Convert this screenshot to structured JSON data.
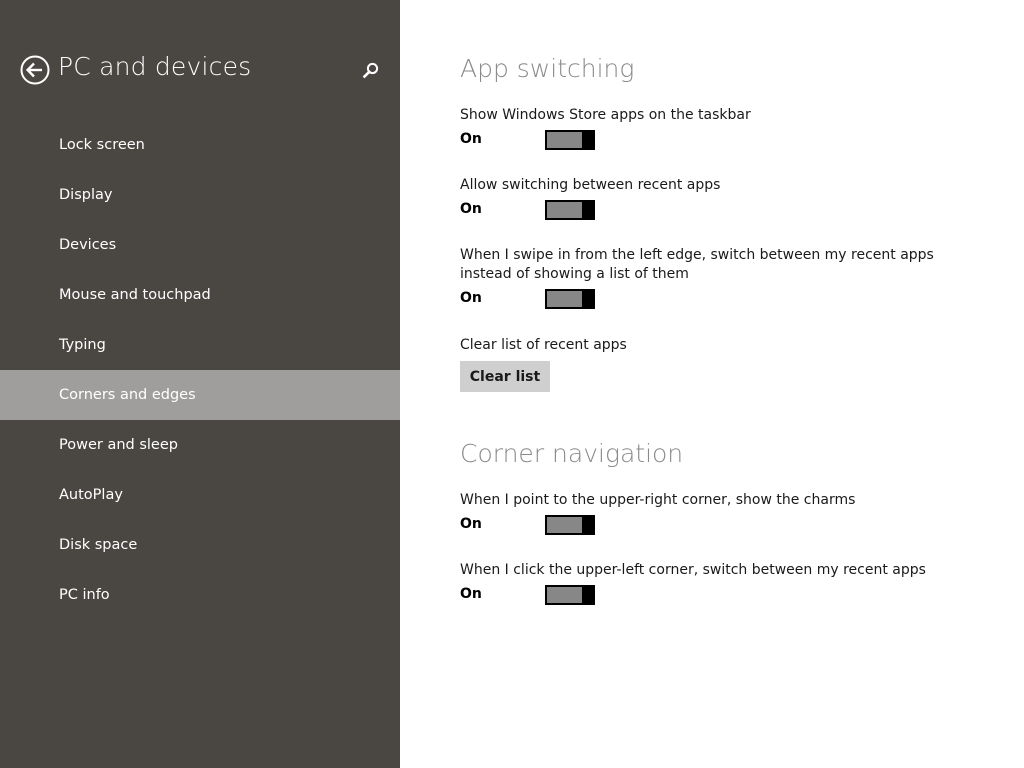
{
  "sidebar": {
    "title": "PC and devices",
    "back_icon": "back-arrow-circle-icon",
    "search_icon": "search-icon",
    "selected_index": 5,
    "items": [
      {
        "label": "Lock screen"
      },
      {
        "label": "Display"
      },
      {
        "label": "Devices"
      },
      {
        "label": "Mouse and touchpad"
      },
      {
        "label": "Typing"
      },
      {
        "label": "Corners and edges"
      },
      {
        "label": "Power and sleep"
      },
      {
        "label": "AutoPlay"
      },
      {
        "label": "Disk space"
      },
      {
        "label": "PC info"
      }
    ]
  },
  "app_switching": {
    "title": "App switching",
    "settings": [
      {
        "label": "Show Windows Store apps on the taskbar",
        "state": "On"
      },
      {
        "label": "Allow switching between recent apps",
        "state": "On"
      },
      {
        "label": "When I swipe in from the left edge, switch between my recent apps instead of showing a list of them",
        "state": "On"
      }
    ],
    "clear_list": {
      "label": "Clear list of recent apps",
      "button": "Clear list"
    }
  },
  "corner_navigation": {
    "title": "Corner navigation",
    "settings": [
      {
        "label": "When I point to the upper-right corner, show the charms",
        "state": "On"
      },
      {
        "label": "When I click the upper-left corner, switch between my recent apps",
        "state": "On"
      }
    ]
  },
  "colors": {
    "sidebar_bg": "#4a4642",
    "sidebar_selected_bg": "#a09e9c",
    "section_title": "#8a8a8a",
    "toggle_track": "#878787",
    "toggle_thumb": "#000000",
    "button_bg": "#cfcfcf"
  }
}
